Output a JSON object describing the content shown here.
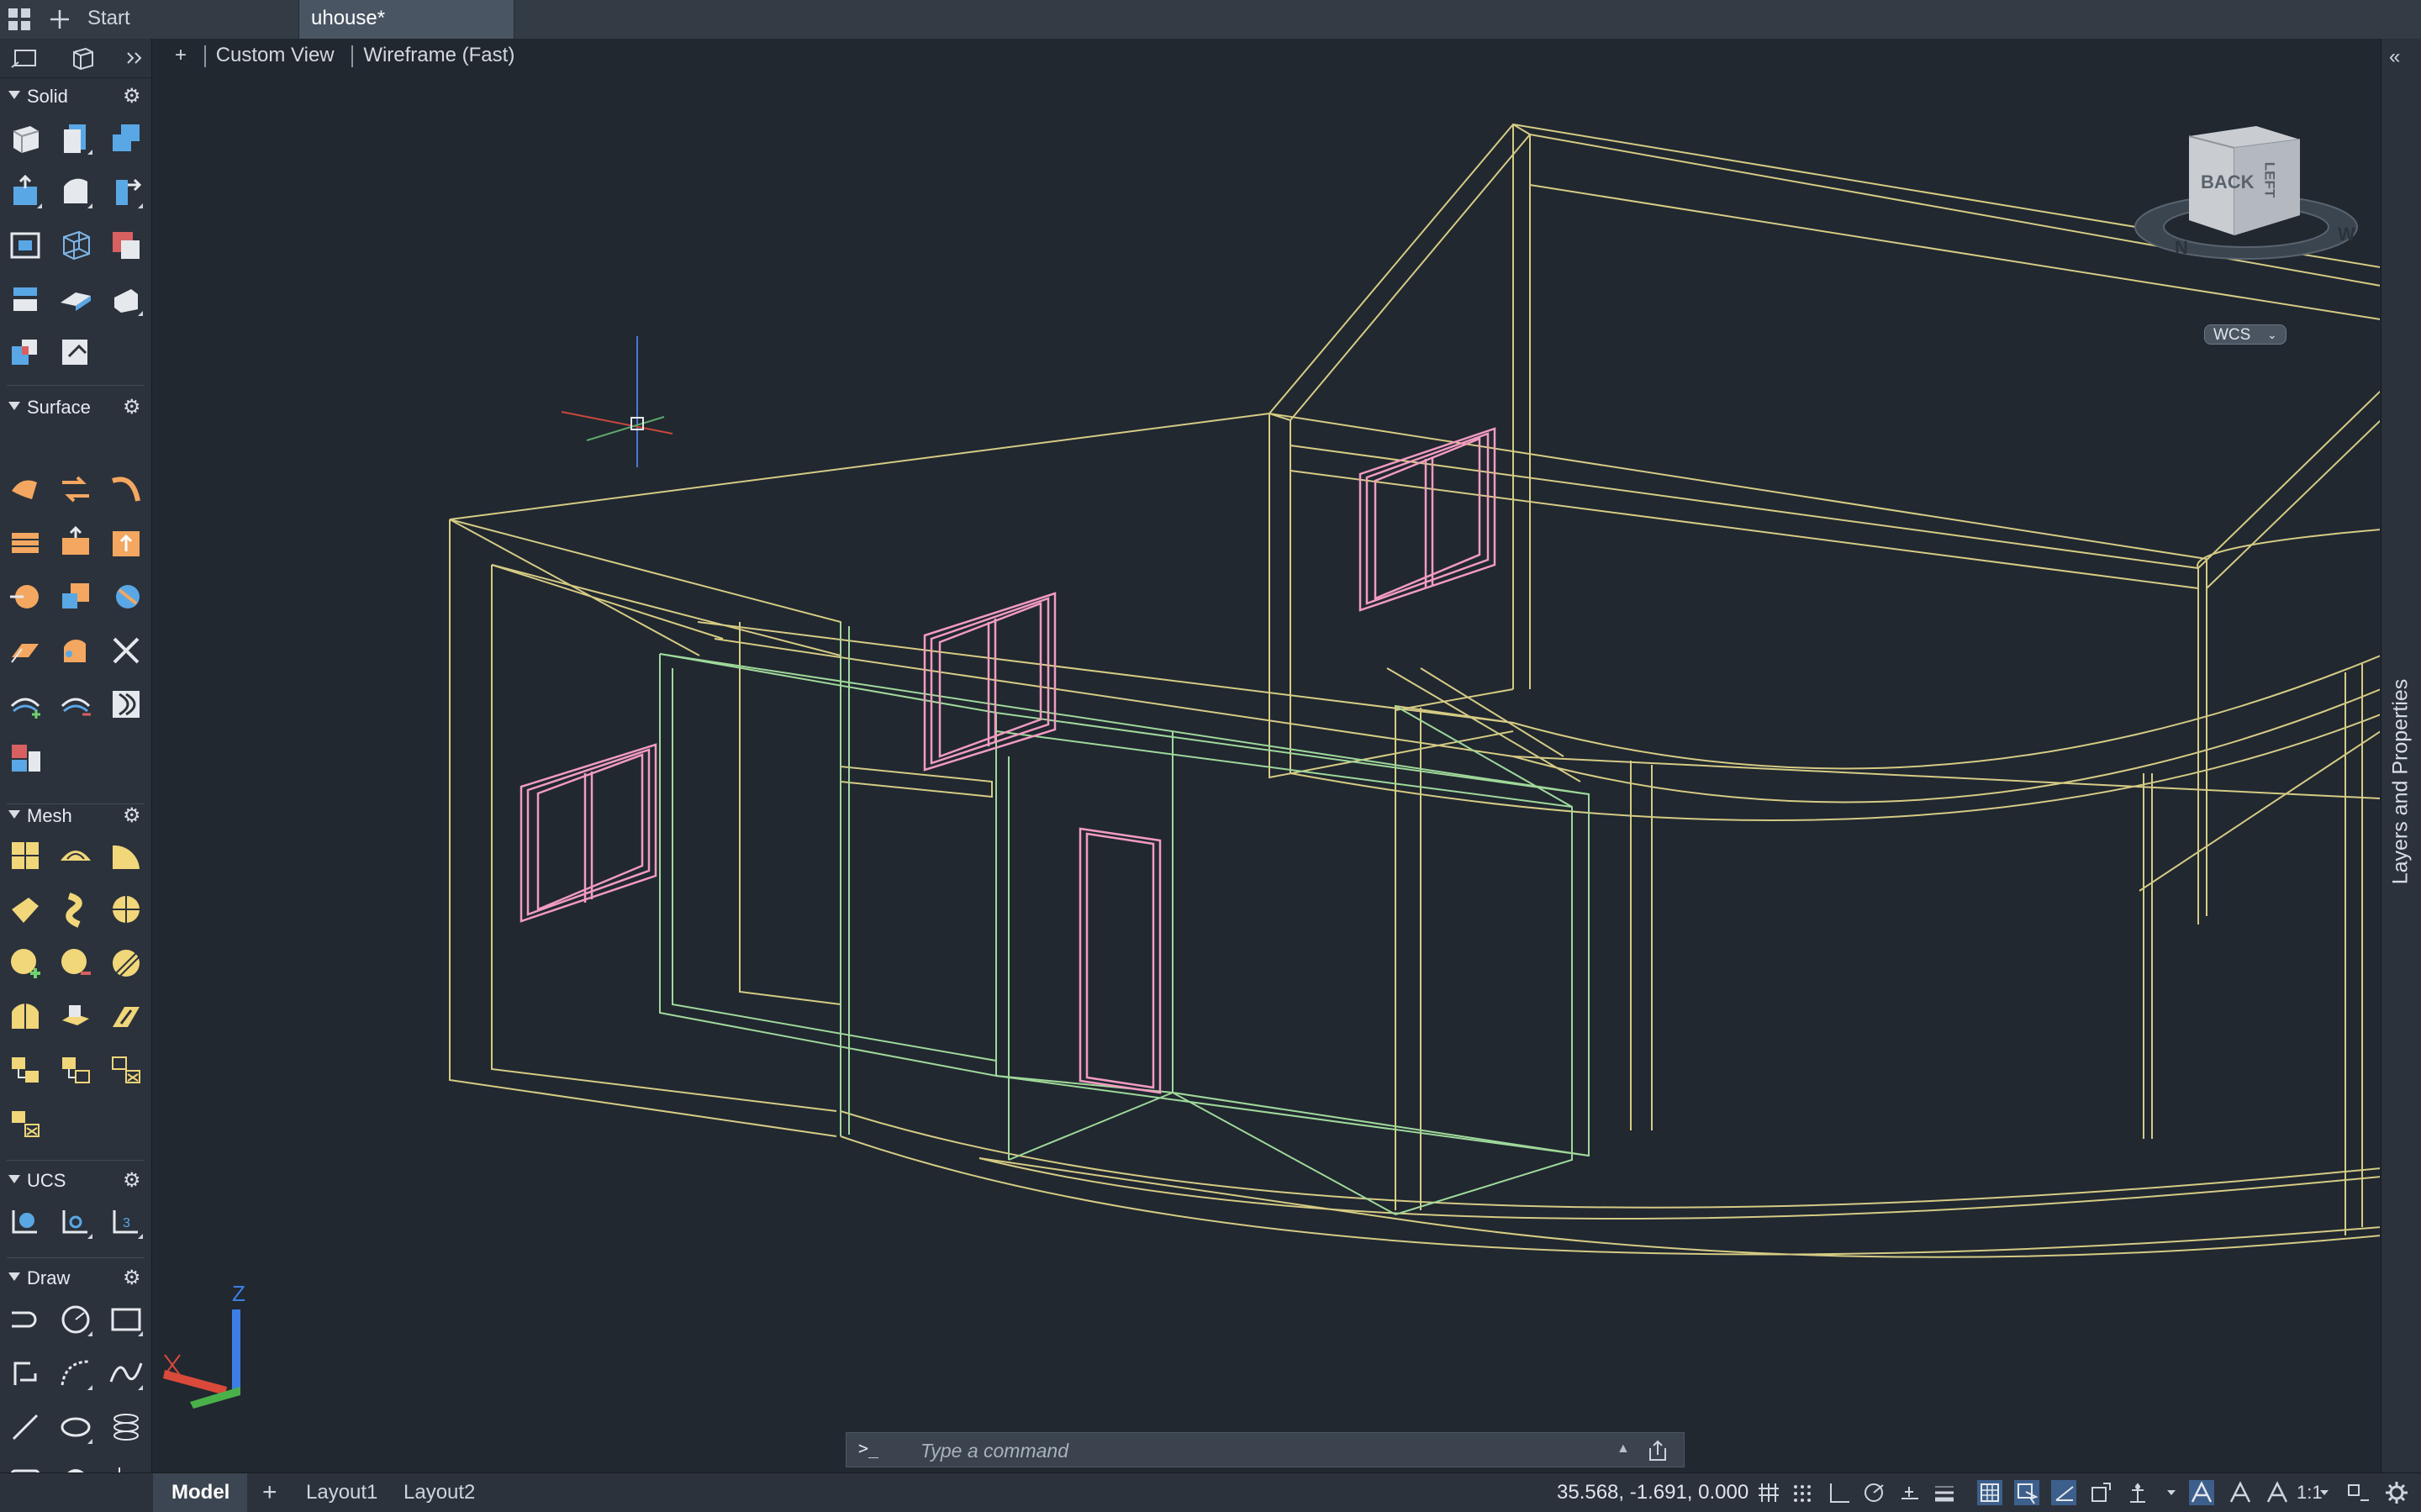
{
  "app": {
    "tabs": [
      {
        "label": "Start"
      },
      {
        "label": "uhouse*"
      }
    ]
  },
  "viewport": {
    "view_name": "Custom View",
    "visual_style": "Wireframe (Fast)",
    "plus_label": "+",
    "viewcube": {
      "back": "BACK",
      "left": "LEFT",
      "north": "N",
      "west": "W"
    },
    "wcs_label": "WCS",
    "ucs_z_label": "Z"
  },
  "palette": {
    "sections": [
      {
        "title": "Solid"
      },
      {
        "title": "Surface"
      },
      {
        "title": "Mesh"
      },
      {
        "title": "UCS"
      },
      {
        "title": "Draw"
      }
    ]
  },
  "right_panel": {
    "label": "Layers and Properties"
  },
  "command": {
    "prompt": ">_",
    "placeholder": "Type a command"
  },
  "status": {
    "layouts": [
      {
        "label": "Model"
      },
      {
        "label": "Layout1"
      },
      {
        "label": "Layout2"
      }
    ],
    "coordinates": "35.568, -1.691, 0.000",
    "scale": "1:1"
  },
  "colors": {
    "background": "#212830",
    "panel": "#2b323b",
    "wire_yellow": "#d6cb84",
    "wire_green": "#9fd89a",
    "wire_pink": "#f29bc0",
    "accent_blue": "#4a90d9"
  }
}
